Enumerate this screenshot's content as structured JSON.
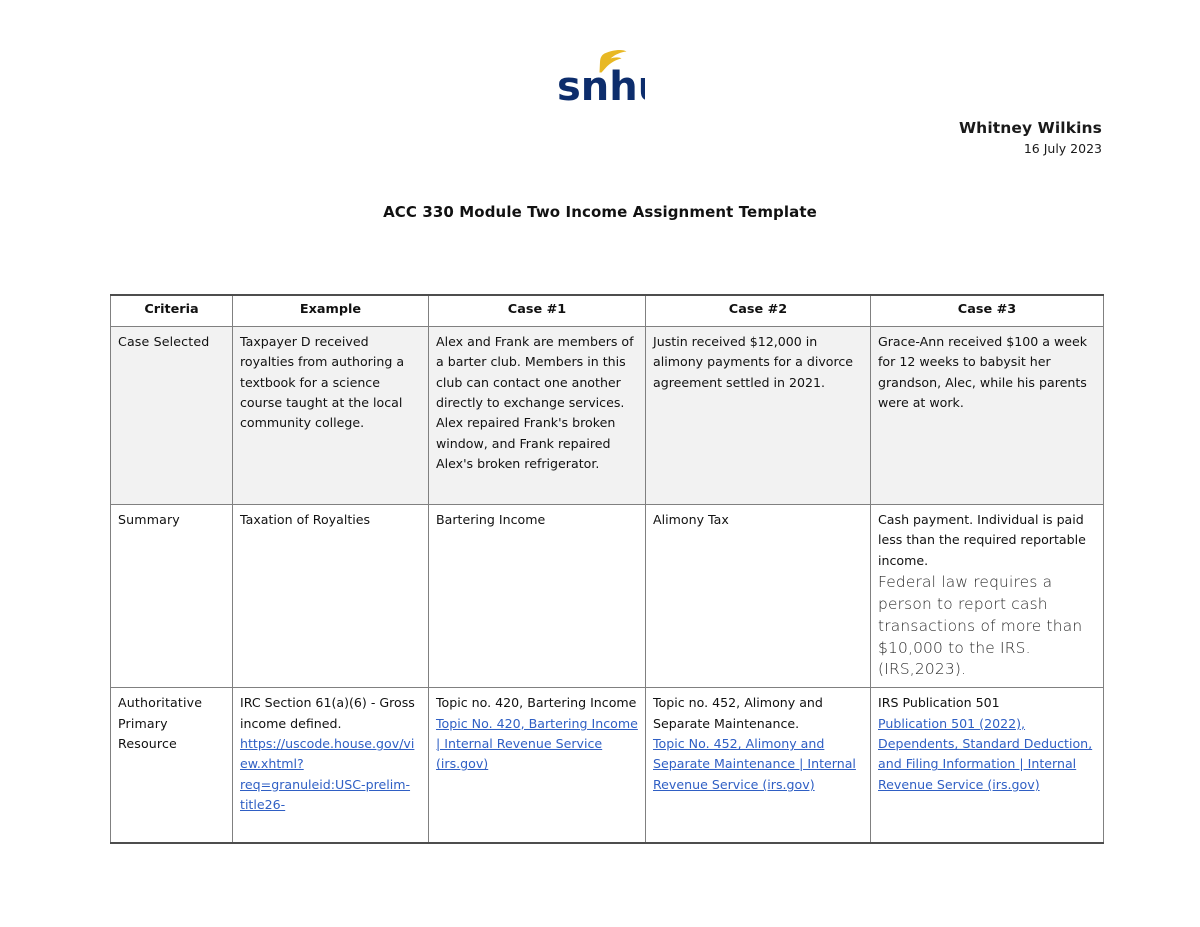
{
  "logo": {
    "wordmark": "snhu",
    "wordmark_color": "#0d2d6c",
    "leaf_color": "#e8b824",
    "alt": "snhu-logo"
  },
  "header": {
    "author": "Whitney Wilkins",
    "date": "16 July 2023"
  },
  "title": "ACC 330 Module Two Income Assignment Template",
  "table": {
    "columns": [
      "Criteria",
      "Example",
      "Case #1",
      "Case #2",
      "Case #3"
    ],
    "rows": [
      {
        "criteria": "Case Selected",
        "example": "Taxpayer D received royalties from authoring a textbook for a science course taught at the local community college.",
        "case1": "Alex and Frank are members of a barter club. Members in this club can contact one another directly to exchange services. Alex repaired Frank's broken window, and Frank repaired Alex's broken refrigerator.",
        "case2": "Justin received $12,000 in alimony payments for a divorce agreement settled in 2021.",
        "case3": "Grace-Ann received $100 a week for 12 weeks to babysit her grandson, Alec, while his parents were at work."
      },
      {
        "criteria": "Summary",
        "example": "Taxation of Royalties",
        "case1": "Bartering Income",
        "case2": "Alimony Tax",
        "case3_part1": "Cash payment.  Individual is paid less than the required reportable income.",
        "case3_part2": "Federal law requires a person to report cash transactions of more than $10,000 to the IRS. (IRS,2023)."
      },
      {
        "criteria": "Authoritative Primary Resource",
        "example_text": "IRC Section 61(a)(6) - Gross income defined.",
        "example_link": "https://uscode.house.gov/view.xhtml?req=granuleid:USC-prelim-title26-",
        "case1_text": "Topic no. 420, Bartering Income",
        "case1_link": "Topic No. 420, Bartering Income | Internal Revenue Service (irs.gov)",
        "case2_text": "Topic no. 452, Alimony and Separate Maintenance.",
        "case2_link": "Topic No. 452, Alimony and Separate Maintenance | Internal Revenue Service (irs.gov)",
        "case3_text": "IRS Publication 501",
        "case3_link": "Publication 501 (2022), Dependents, Standard Deduction, and Filing Information | Internal Revenue Service (irs.gov)"
      }
    ]
  },
  "colors": {
    "link": "#2f5fc4",
    "border": "#808080",
    "shaded_row": "#f2f2f2",
    "brand_navy": "#0d2d6c",
    "brand_gold": "#e8b824"
  }
}
